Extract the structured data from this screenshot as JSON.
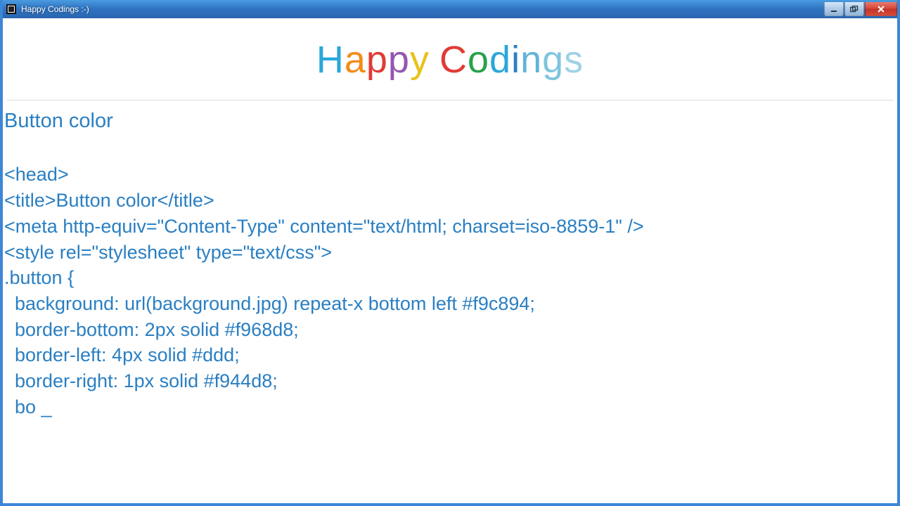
{
  "window": {
    "title": "Happy Codings :-)"
  },
  "logo": {
    "word1": {
      "H": "H",
      "a": "a",
      "p": "p",
      "p2": "p",
      "y": "y"
    },
    "word2": {
      "C": "C",
      "o": "o",
      "d": "d",
      "i": "i",
      "n": "n",
      "g": "g",
      "s": "s"
    }
  },
  "content": {
    "title": "Button color",
    "lines": [
      "<head>",
      "<title>Button color</title>",
      "<meta http-equiv=\"Content-Type\" content=\"text/html; charset=iso-8859-1\" />",
      "<style rel=\"stylesheet\" type=\"text/css\">",
      ".button {",
      "  background: url(background.jpg) repeat-x bottom left #f9c894;",
      "  border-bottom: 2px solid #f968d8;",
      "  border-left: 4px solid #ddd;",
      "  border-right: 1px solid #f944d8;",
      "  bo _"
    ]
  }
}
